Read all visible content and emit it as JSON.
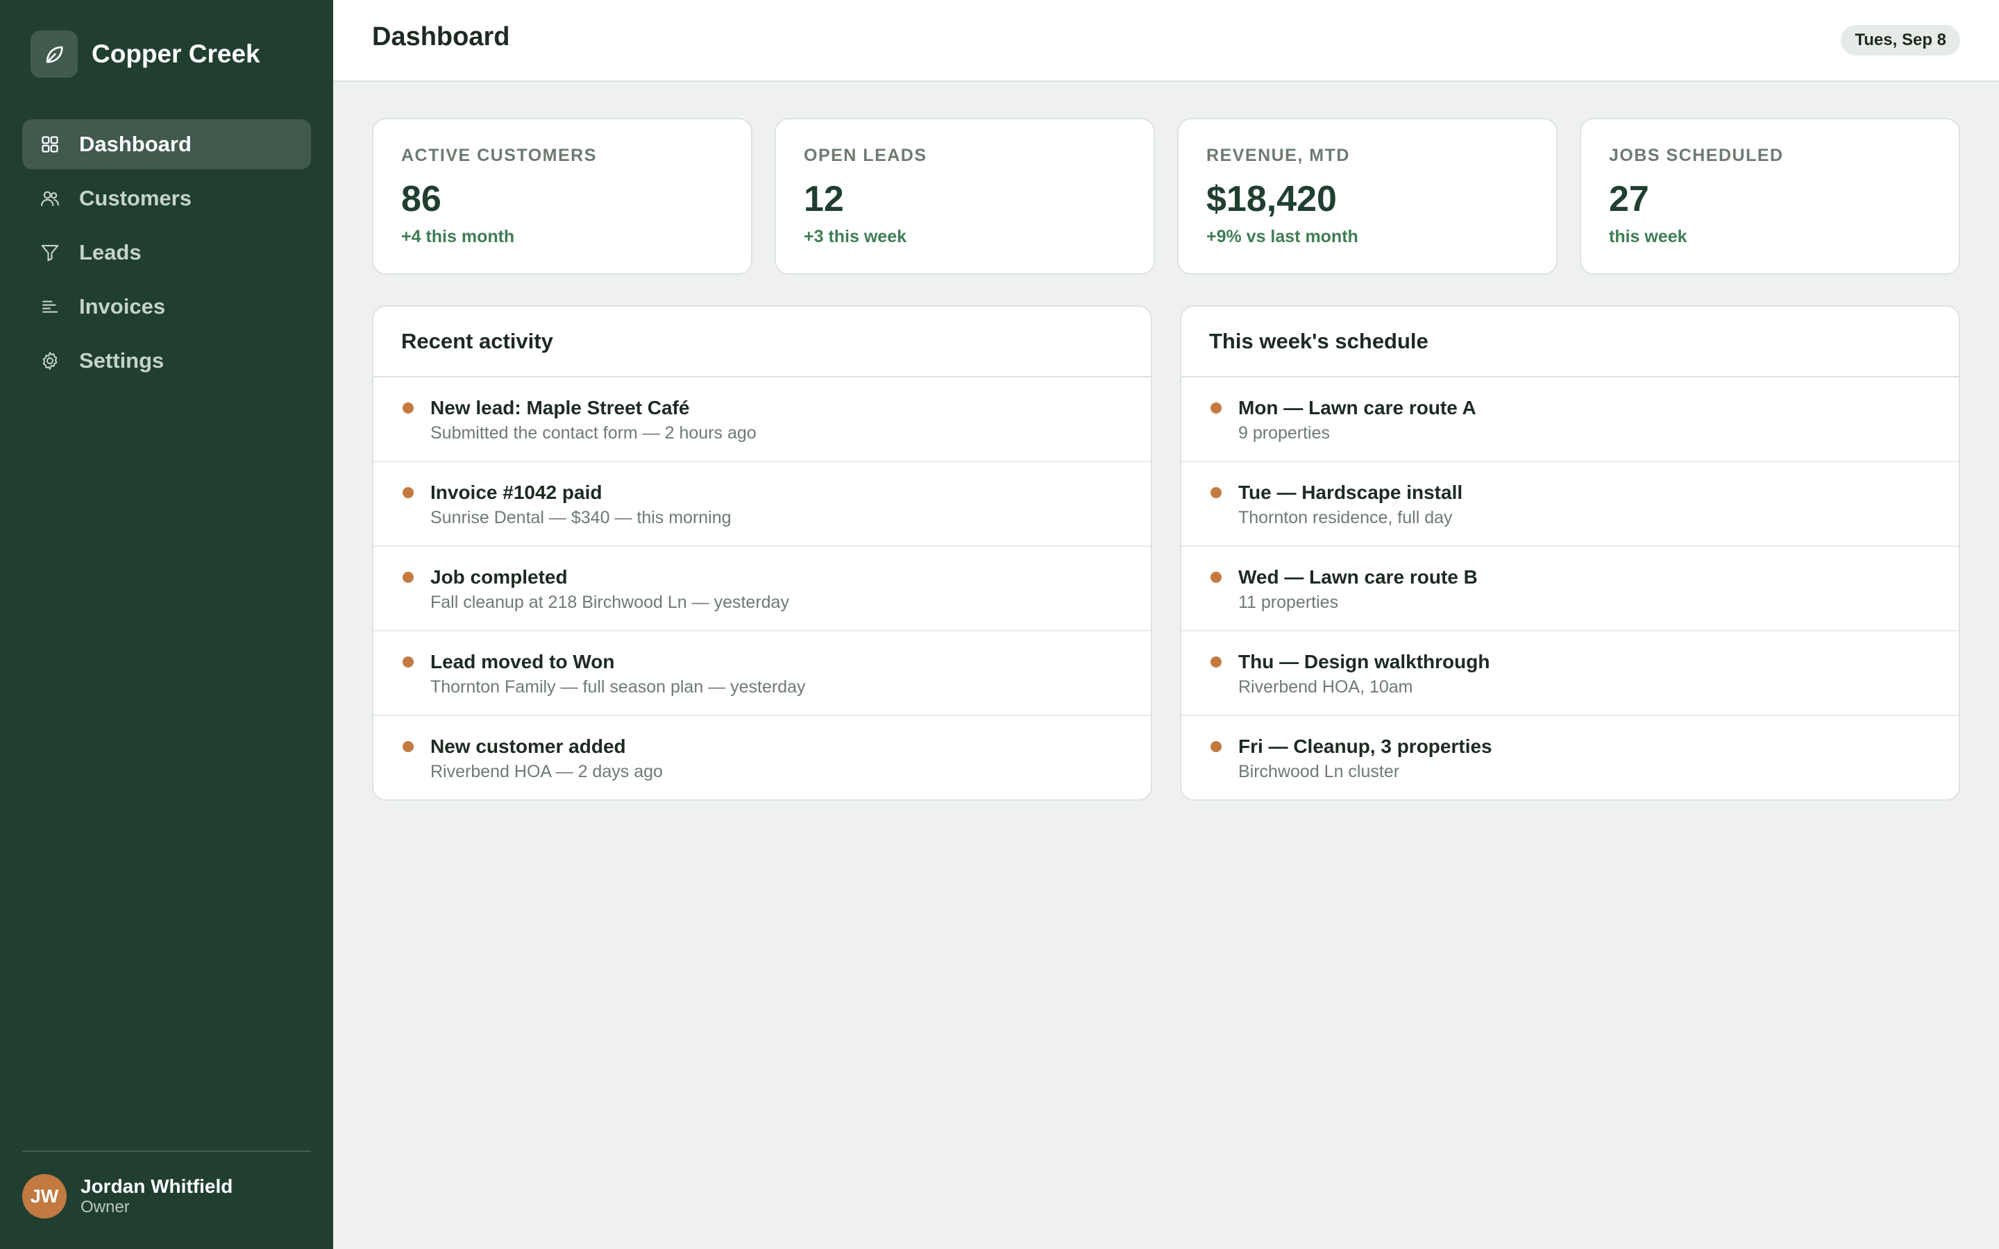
{
  "brand": {
    "name": "Copper Creek",
    "icon": "leaf-icon"
  },
  "sidebar": {
    "items": [
      {
        "label": "Dashboard",
        "icon": "grid-icon",
        "active": true
      },
      {
        "label": "Customers",
        "icon": "users-icon",
        "active": false
      },
      {
        "label": "Leads",
        "icon": "filter-icon",
        "active": false
      },
      {
        "label": "Invoices",
        "icon": "list-icon",
        "active": false
      },
      {
        "label": "Settings",
        "icon": "gear-icon",
        "active": false
      }
    ]
  },
  "user": {
    "initials": "JW",
    "name": "Jordan Whitfield",
    "role": "Owner"
  },
  "header": {
    "title": "Dashboard",
    "date": "Tues, Sep 8"
  },
  "stats": [
    {
      "label": "ACTIVE CUSTOMERS",
      "value": "86",
      "delta": "+4 this month"
    },
    {
      "label": "OPEN LEADS",
      "value": "12",
      "delta": "+3 this week"
    },
    {
      "label": "REVENUE, MTD",
      "value": "$18,420",
      "delta": "+9% vs last month"
    },
    {
      "label": "JOBS SCHEDULED",
      "value": "27",
      "delta": "this week"
    }
  ],
  "activity": {
    "title": "Recent activity",
    "items": [
      {
        "title": "New lead: Maple Street Café",
        "sub": "Submitted the contact form — 2 hours ago"
      },
      {
        "title": "Invoice #1042 paid",
        "sub": "Sunrise Dental — $340 — this morning"
      },
      {
        "title": "Job completed",
        "sub": "Fall cleanup at 218 Birchwood Ln — yesterday"
      },
      {
        "title": "Lead moved to Won",
        "sub": "Thornton Family — full season plan — yesterday"
      },
      {
        "title": "New customer added",
        "sub": "Riverbend HOA — 2 days ago"
      }
    ]
  },
  "schedule": {
    "title": "This week's schedule",
    "items": [
      {
        "title": "Mon — Lawn care route A",
        "sub": "9 properties"
      },
      {
        "title": "Tue — Hardscape install",
        "sub": "Thornton residence, full day"
      },
      {
        "title": "Wed — Lawn care route B",
        "sub": "11 properties"
      },
      {
        "title": "Thu — Design walkthrough",
        "sub": "Riverbend HOA, 10am"
      },
      {
        "title": "Fri — Cleanup, 3 properties",
        "sub": "Birchwood Ln cluster"
      }
    ]
  },
  "colors": {
    "sidebar": "#213f31",
    "accent": "#c27a41",
    "positive": "#3f7d54",
    "background": "#eff1ee"
  }
}
